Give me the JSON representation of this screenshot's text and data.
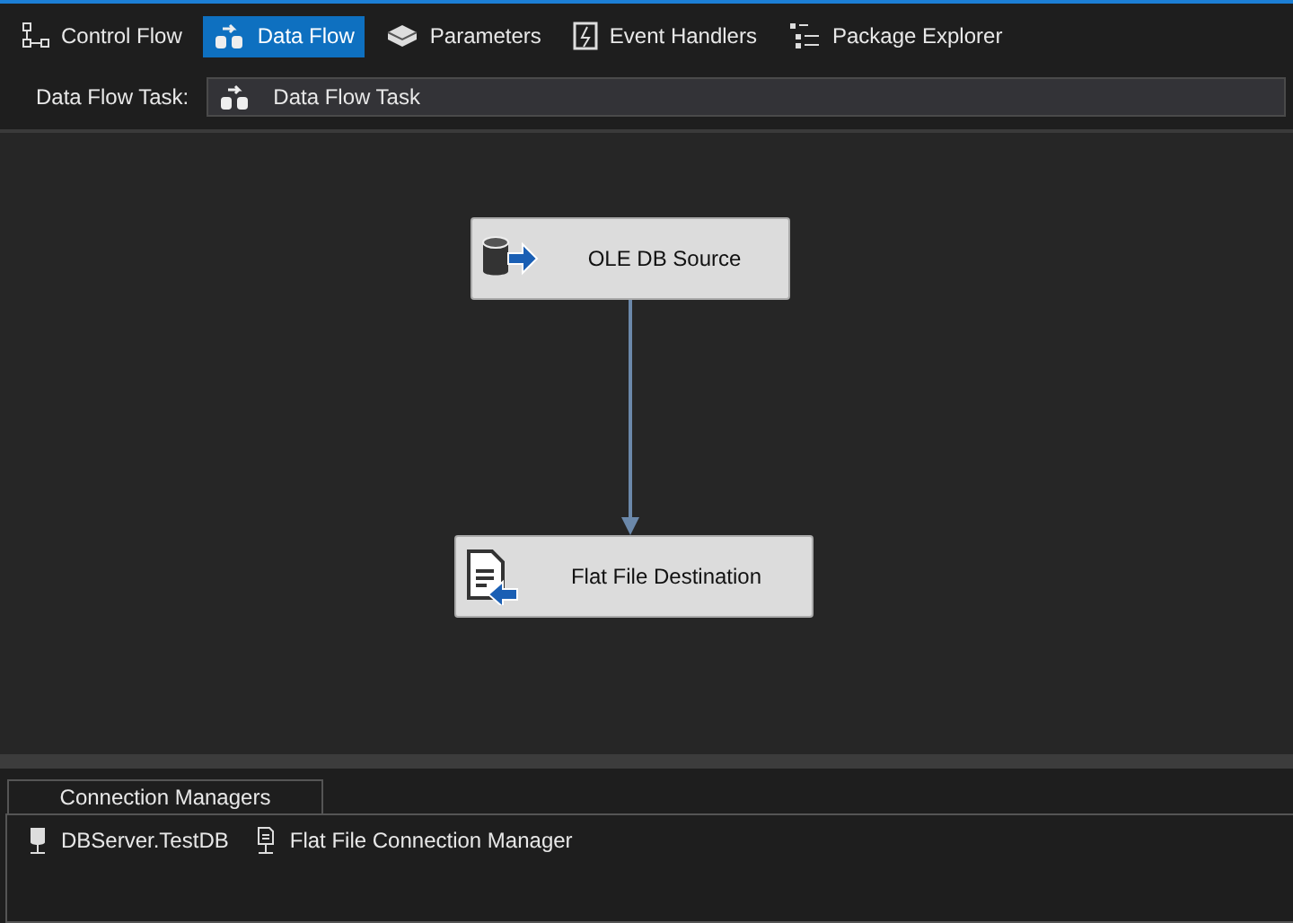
{
  "tabs": [
    {
      "label": "Control Flow",
      "kind": "control",
      "selected": false
    },
    {
      "label": "Data Flow",
      "kind": "dataflow",
      "selected": true
    },
    {
      "label": "Parameters",
      "kind": "parameters",
      "selected": false
    },
    {
      "label": "Event Handlers",
      "kind": "events",
      "selected": false
    },
    {
      "label": "Package Explorer",
      "kind": "explorer",
      "selected": false
    }
  ],
  "task_selector": {
    "label": "Data Flow Task:",
    "value": "Data Flow Task"
  },
  "canvas": {
    "nodes": [
      {
        "label": "OLE DB Source",
        "kind": "source"
      },
      {
        "label": "Flat File Destination",
        "kind": "destination"
      }
    ]
  },
  "connection_managers": {
    "tab": "Connection Managers",
    "items": [
      {
        "label": "DBServer.TestDB",
        "kind": "database"
      },
      {
        "label": "Flat File Connection Manager",
        "kind": "flatfile"
      }
    ]
  }
}
